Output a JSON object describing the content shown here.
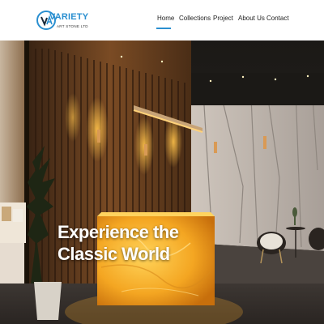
{
  "brand": {
    "name": "VARIETY",
    "tagline": "ART STONE LTD",
    "mark": "VA",
    "color": "#2a8fd0"
  },
  "nav": {
    "items": [
      {
        "label": "Home",
        "active": true
      },
      {
        "label": "Collections",
        "active": false
      },
      {
        "label": "Project",
        "active": false
      },
      {
        "label": "About Us",
        "active": false
      },
      {
        "label": "Contact",
        "active": false
      }
    ]
  },
  "hero": {
    "line1": "Experience the",
    "line2": "Classic World"
  }
}
